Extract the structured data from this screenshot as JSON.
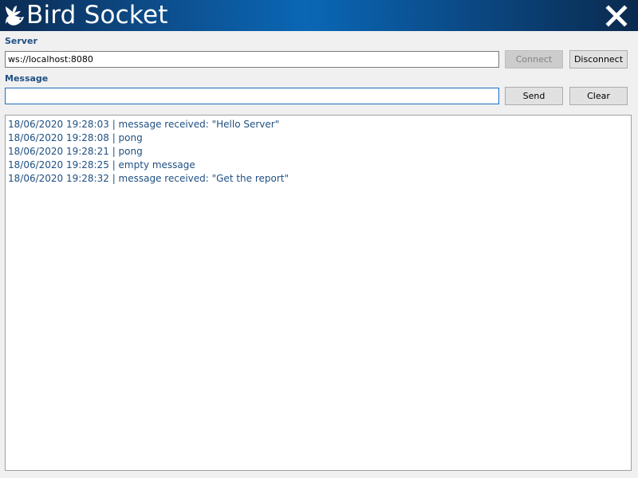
{
  "app": {
    "title": "Bird Socket",
    "logo_icon": "bird-logo-icon",
    "close_icon": "close-icon"
  },
  "server": {
    "label": "Server",
    "url_value": "ws://localhost:8080",
    "connect_label": "Connect",
    "connect_enabled": false,
    "disconnect_label": "Disconnect"
  },
  "message": {
    "label": "Message",
    "value": "",
    "send_label": "Send",
    "clear_label": "Clear"
  },
  "log": {
    "lines": [
      "18/06/2020 19:28:03 | message received: \"Hello Server\"",
      "18/06/2020 19:28:08 | pong",
      "18/06/2020 19:28:21 | pong",
      "18/06/2020 19:28:25 | empty message",
      "18/06/2020 19:28:32 | message received: \"Get the report\""
    ]
  },
  "colors": {
    "titlebar_dark": "#0b2b52",
    "titlebar_light": "#0a67b5",
    "label_text": "#1f4f82",
    "log_text": "#1f4f82",
    "focus_border": "#1a6fc2"
  }
}
